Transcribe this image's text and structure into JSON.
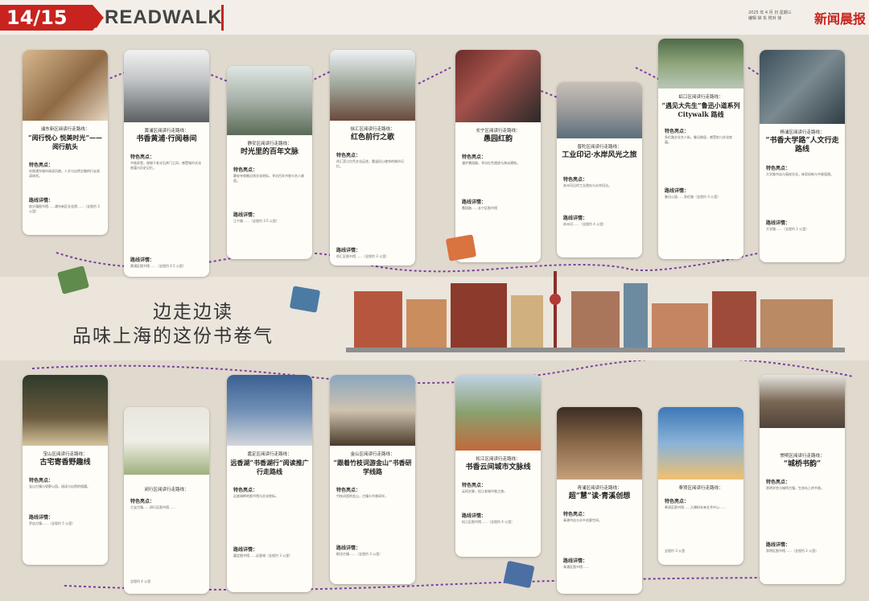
{
  "header": {
    "page_number": "14/15",
    "section": "READWALK",
    "meta_lines": [
      "2025 年 4 月 日 星期三",
      "编辑 徐 东 校对 徐"
    ],
    "logo": "新闻晨报"
  },
  "slogan": {
    "line1": "边走边读",
    "line2": "品味上海的这份书卷气"
  },
  "labels": {
    "features": "特色亮点：",
    "route": "路线详情：",
    "route_detail": "路线详情："
  },
  "top_cards": [
    {
      "district": "浦东新区阅读行走路线：",
      "title": "“阅行悦心 悦美时光”——阅行航头",
      "feature": "实践浦东城市阅读风貌，人文与自然交融的行走阅读体验。",
      "route": "航头镇图书馆……浦东新区文化馆……（全程约 3 公里）"
    },
    {
      "district": "黄浦区阅读行走路线：",
      "title": "书香黄浦·行阅巷间",
      "feature": "书香弄堂，穿梭于老式石库门之间，感受城市文化底蕴与历史记忆。",
      "route": "黄浦区图书馆……（全程约 4.5 公里）"
    },
    {
      "district": "静安区阅读行走路线：",
      "title": "时光里的百年文脉",
      "feature": "静安寺商圈沿线文化地标，寻访百年书香与名人故居。",
      "route": "江宁路……（全程约 3.5 公里）"
    },
    {
      "district": "徐汇区阅读行走路线：",
      "title": "红色前行之歌",
      "feature": "徐汇滨江红色文化足迹，重温初心使命的城市记忆。",
      "route": "徐汇区图书馆……（全程约 3 公里）"
    },
    {
      "district": "长宁区阅读行走路线：",
      "title": "愚园红韵",
      "feature": "漫步愚园路，寻访红色遗迹与海派建筑。",
      "route": "愚园路……长宁区图书馆"
    },
    {
      "district": "普陀区阅读行走路线：",
      "title": "工业印记·水岸风光之旅",
      "feature": "苏州河沿岸工业遗存与水岸风光。",
      "route": "苏州河……（全程约 4 公里）"
    },
    {
      "district": "虹口区阅读行走路线：",
      "title": "“遇见大先生”鲁迅小道系列 Citywalk 路线",
      "feature": "多伦路文化名人街、鲁迅故居，感受虹口文化底蕴。",
      "route": "鲁迅公园……多伦路（全程约 3 公里）"
    },
    {
      "district": "杨浦区阅读行走路线：",
      "title": "“书香大学路”人文行走路线",
      "feature": "大学路书店与高校文化，体验创新与书香氛围。",
      "route": "大学路……（全程约 2 公里）"
    }
  ],
  "bottom_cards": [
    {
      "district": "宝山区阅读行走路线：",
      "title": "古宅寄香野趣线",
      "feature": "宝山古镇与郊野公园，阅读与自然的相遇。",
      "route": "罗店古镇……（全程约 5 公里）"
    },
    {
      "district": "闵行区阅读行走路线：",
      "title": "",
      "feature": "七宝古镇……闵行区图书馆……",
      "route": "全程约 4 公里"
    },
    {
      "district": "嘉定区阅读行走路线：",
      "title": "远香湖“书香湖行”阅读推广行走路线",
      "feature": "远香湖畔的图书馆与文化地标。",
      "route": "嘉定图书馆……远香湖（全程约 3 公里）"
    },
    {
      "district": "金山区阅读行走路线：",
      "title": "“跟着竹枝词游金山”书香研学线路",
      "feature": "竹枝词里的金山，古镇与书香研学。",
      "route": "枫泾古镇……（全程约 3 公里）"
    },
    {
      "district": "松江区阅读行走路线：",
      "title": "书香云间城市文脉线",
      "feature": "云间文脉，松江老城书香之旅。",
      "route": "松江区图书馆……（全程约 4 公里）"
    },
    {
      "district": "青浦区阅读行走路线：",
      "title": "超“慧”读·青溪创想",
      "feature": "青浦书店与水乡创意空间。",
      "route": "青浦区图书馆……"
    },
    {
      "district": "奉贤区阅读行走路线：",
      "title": "",
      "feature": "奉贤区图书馆……九棵树未来艺术中心……",
      "route": "全程约 3 公里"
    },
    {
      "district": "崇明区阅读行走路线：",
      "title": "“城桥书韵”",
      "feature": "崇明学宫与城桥古镇，生态岛上的书香。",
      "route": "崇明区图书馆……（全程约 2 公里）"
    }
  ],
  "colors": {
    "accent": "#c8231f",
    "route_line": "#7b3fa0"
  }
}
